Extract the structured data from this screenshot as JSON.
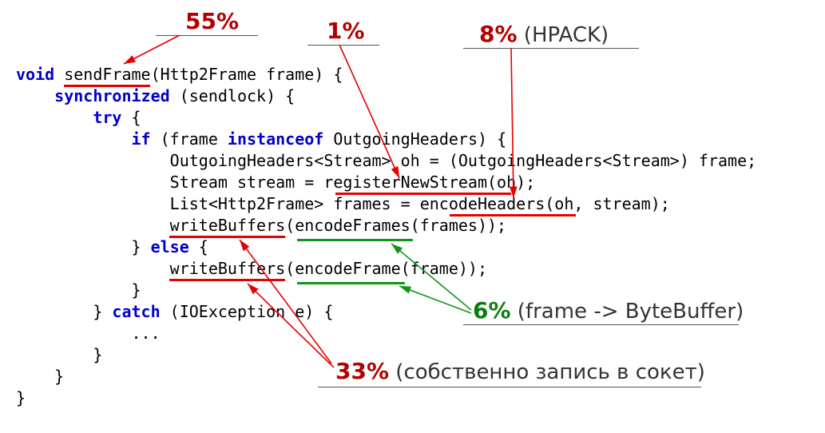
{
  "code": {
    "l1": {
      "k1": "void",
      "id": "sendFrame",
      "sig": "(Http2Frame frame) {"
    },
    "l2": {
      "k1": "synchronized",
      "rest": " (sendlock) {"
    },
    "l3": {
      "k1": "try",
      "rest": " {"
    },
    "l4": {
      "k1": "if",
      "mid": " (frame ",
      "k2": "instanceof",
      "rest": " OutgoingHeaders) {"
    },
    "l5": "OutgoingHeaders<Stream> oh = (OutgoingHeaders<Stream>) frame;",
    "l6": "Stream stream = registerNewStream(oh);",
    "l7": "List<Http2Frame> frames = encodeHeaders(oh, stream);",
    "l8": "writeBuffers(encodeFrames(frames));",
    "l9": {
      "brace": "} ",
      "k1": "else",
      "rest": " {"
    },
    "l10": "writeBuffers(encodeFrame(frame));",
    "l11": "}",
    "l12": {
      "brace": "} ",
      "k1": "catch",
      "rest": " (IOException e) {"
    },
    "l13": "...",
    "l14": "}",
    "l15": "}",
    "l16": "}"
  },
  "annotations": {
    "a55": {
      "pct": "55%",
      "note": ""
    },
    "a1": {
      "pct": "1%",
      "note": ""
    },
    "a8": {
      "pct": "8%",
      "note": " (HPACK)"
    },
    "a6": {
      "pct": "6%",
      "note": " (frame -> ByteBuffer)"
    },
    "a33": {
      "pct": "33%",
      "note": " (собственно запись в сокет)"
    }
  }
}
